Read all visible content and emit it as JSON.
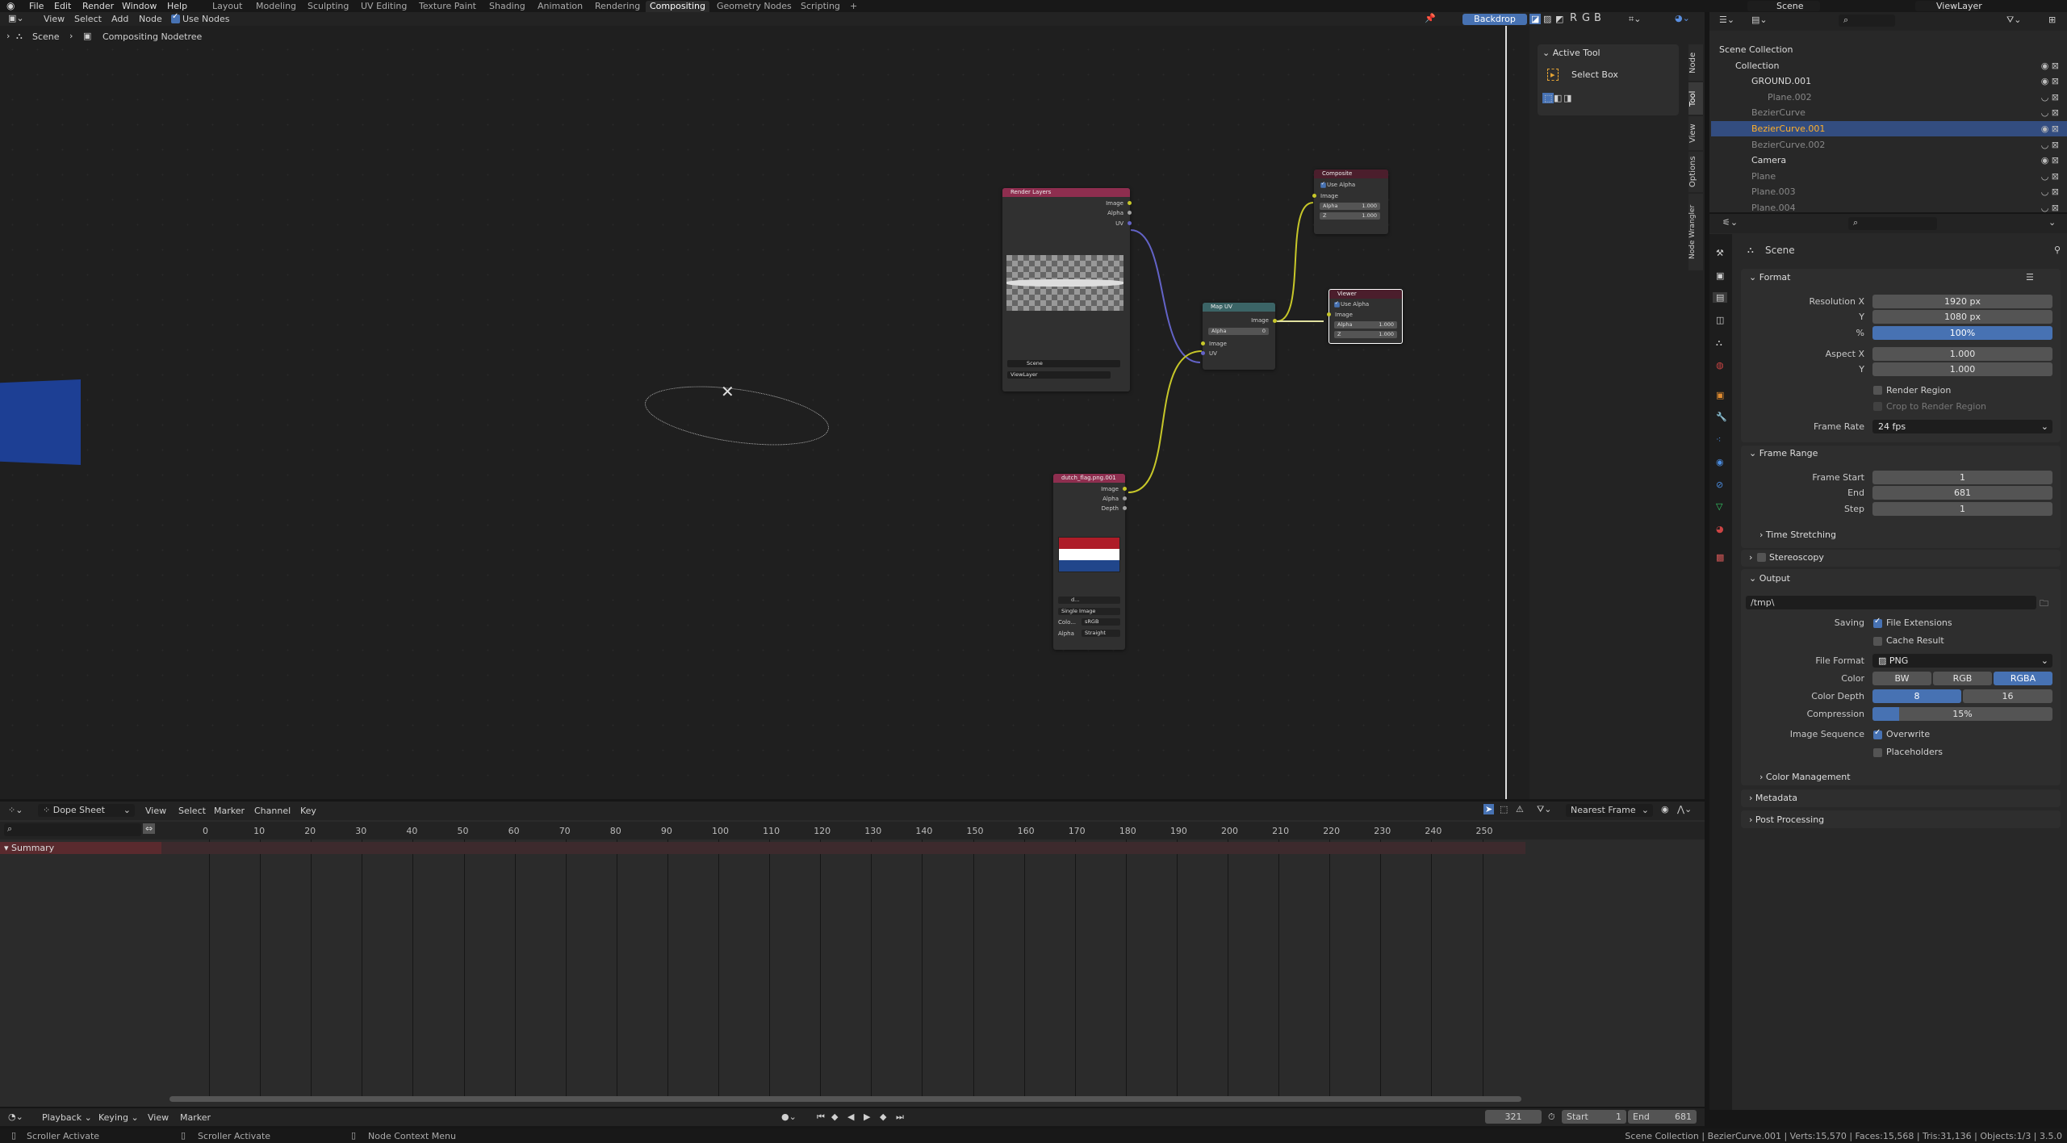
{
  "topbar": {
    "menus": [
      "File",
      "Edit",
      "Render",
      "Window",
      "Help"
    ],
    "workspaces": [
      "Layout",
      "Modeling",
      "Sculpting",
      "UV Editing",
      "Texture Paint",
      "Shading",
      "Animation",
      "Rendering",
      "Compositing",
      "Geometry Nodes",
      "Scripting",
      "+"
    ],
    "active_workspace": "Compositing",
    "scene": "Scene",
    "view_layer": "ViewLayer"
  },
  "node_editor": {
    "menus": [
      "View",
      "Select",
      "Add",
      "Node"
    ],
    "use_nodes": "Use Nodes",
    "use_nodes_checked": true,
    "breadcrumb": [
      "Scene",
      "Compositing Nodetree"
    ],
    "backdrop": "Backdrop",
    "channels": [
      "R",
      "G",
      "B"
    ],
    "sidebar": {
      "panel": "Active Tool",
      "tool": "Select Box",
      "tabs": [
        "Node",
        "Tool",
        "View",
        "Options",
        "Node Wrangler"
      ]
    },
    "nodes": {
      "render_layers": {
        "title": "Render Layers",
        "outputs": [
          "Image",
          "Alpha",
          "UV"
        ],
        "scene": "Scene",
        "layer": "ViewLayer"
      },
      "composite": {
        "title": "Composite",
        "use_alpha": "Use Alpha",
        "input": "Image",
        "alpha_label": "Alpha",
        "alpha": "1.000",
        "z_label": "Z",
        "z": "1.000"
      },
      "map_uv": {
        "title": "Map UV",
        "output": "Image",
        "alpha_label": "Alpha",
        "alpha": "0",
        "inputs": [
          "Image",
          "UV"
        ]
      },
      "viewer": {
        "title": "Viewer",
        "use_alpha": "Use Alpha",
        "input": "Image",
        "alpha_label": "Alpha",
        "alpha": "1.000",
        "z_label": "Z",
        "z": "1.000"
      },
      "image": {
        "title": "dutch_flag.png.001",
        "outputs": [
          "Image",
          "Alpha",
          "Depth"
        ],
        "image_name": "d...",
        "source": "Single Image",
        "color_label": "Colo...",
        "color_space": "sRGB",
        "alpha_label": "Alpha",
        "alpha_mode": "Straight",
        "flag_colors": [
          "#ae1c28",
          "#ffffff",
          "#21468b"
        ]
      }
    }
  },
  "outliner": {
    "rows": [
      {
        "name": "Scene Collection",
        "indent": 0
      },
      {
        "name": "Collection",
        "indent": 1
      },
      {
        "name": "GROUND.001",
        "indent": 2
      },
      {
        "name": "Plane.002",
        "indent": 3
      },
      {
        "name": "BezierCurve",
        "indent": 2
      },
      {
        "name": "BezierCurve.001",
        "indent": 2,
        "selected": true
      },
      {
        "name": "BezierCurve.002",
        "indent": 2
      },
      {
        "name": "Camera",
        "indent": 2
      },
      {
        "name": "Plane",
        "indent": 2
      },
      {
        "name": "Plane.003",
        "indent": 2
      },
      {
        "name": "Plane.004",
        "indent": 2
      }
    ]
  },
  "properties": {
    "context": "Scene",
    "format": {
      "title": "Format",
      "res_x_label": "Resolution X",
      "res_x": "1920 px",
      "res_y_label": "Y",
      "res_y": "1080 px",
      "pct_label": "%",
      "pct": "100%",
      "aspect_x_label": "Aspect X",
      "aspect_x": "1.000",
      "aspect_y_label": "Y",
      "aspect_y": "1.000",
      "render_region": "Render Region",
      "crop": "Crop to Render Region",
      "frame_rate_label": "Frame Rate",
      "frame_rate": "24 fps"
    },
    "frame_range": {
      "title": "Frame Range",
      "start_label": "Frame Start",
      "start": "1",
      "end_label": "End",
      "end": "681",
      "step_label": "Step",
      "step": "1",
      "time_stretching": "Time Stretching"
    },
    "stereoscopy": "Stereoscopy",
    "output": {
      "title": "Output",
      "path": "/tmp\\",
      "saving_label": "Saving",
      "file_ext": "File Extensions",
      "cache": "Cache Result",
      "format_label": "File Format",
      "format": "PNG",
      "color_label": "Color",
      "color_opts": [
        "BW",
        "RGB",
        "RGBA"
      ],
      "color_active": "RGBA",
      "depth_label": "Color Depth",
      "depth_opts": [
        "8",
        "16"
      ],
      "depth_active": "8",
      "compression_label": "Compression",
      "compression": "15%",
      "compression_value": 15,
      "seq_label": "Image Sequence",
      "overwrite": "Overwrite",
      "placeholders": "Placeholders",
      "color_mgmt": "Color Management"
    },
    "metadata": "Metadata",
    "post": "Post Processing"
  },
  "dopesheet": {
    "mode": "Dope Sheet",
    "menus": [
      "View",
      "Select",
      "Marker",
      "Channel",
      "Key"
    ],
    "snap": "Nearest Frame",
    "ticks": [
      0,
      10,
      20,
      30,
      40,
      50,
      60,
      70,
      80,
      90,
      100,
      110,
      120,
      130,
      140,
      150,
      160,
      170,
      180,
      190,
      200,
      210,
      220,
      230,
      240,
      250
    ],
    "summary": "Summary"
  },
  "timeline": {
    "menus": [
      "Playback",
      "Keying",
      "View",
      "Marker"
    ],
    "current_frame": "321",
    "start_label": "Start",
    "start": "1",
    "end_label": "End",
    "end": "681"
  },
  "status": {
    "hints": [
      "Scroller Activate",
      "Scroller Activate",
      "Node Context Menu"
    ],
    "stats": "Scene Collection | BezierCurve.001 | Verts:15,570 | Faces:15,568 | Tris:31,136 | Objects:1/3 | 3.5.0"
  }
}
